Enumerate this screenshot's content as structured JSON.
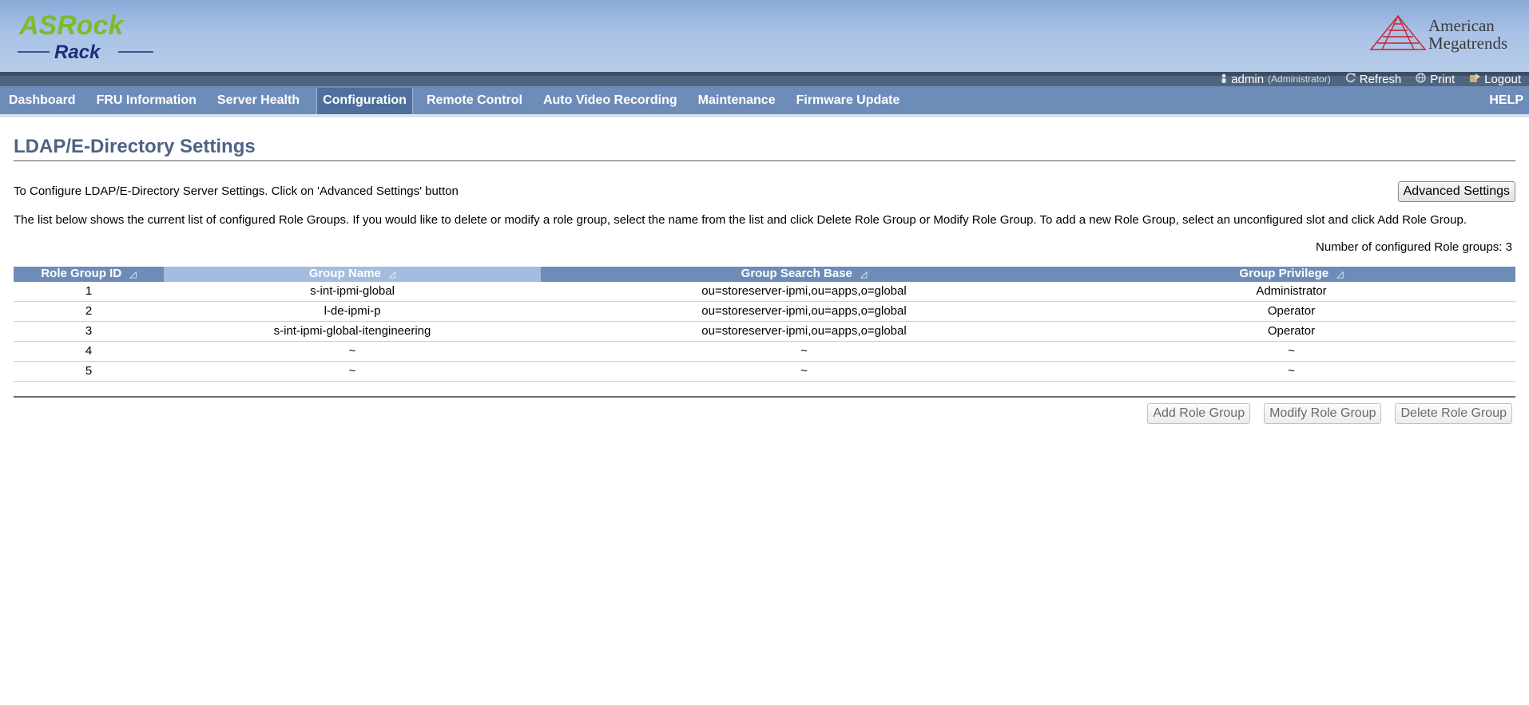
{
  "brand": {
    "left_logo_top": "ASRock",
    "left_logo_bottom": "Rack",
    "right_logo_line1": "American",
    "right_logo_line2": "Megatrends",
    "left_logo_green": "#7dbb2c",
    "left_logo_navy": "#1d2d7a",
    "right_logo_red": "#c8202c"
  },
  "userbar": {
    "user": "admin",
    "role": "(Administrator)",
    "refresh": "Refresh",
    "print": "Print",
    "logout": "Logout"
  },
  "nav": {
    "items": [
      {
        "label": "Dashboard"
      },
      {
        "label": "FRU Information"
      },
      {
        "label": "Server Health"
      },
      {
        "label": "Configuration",
        "active": true
      },
      {
        "label": "Remote Control"
      },
      {
        "label": "Auto Video Recording"
      },
      {
        "label": "Maintenance"
      },
      {
        "label": "Firmware Update"
      }
    ],
    "help": "HELP"
  },
  "page": {
    "title": "LDAP/E-Directory Settings",
    "intro": "To Configure LDAP/E-Directory Server Settings. Click on 'Advanced Settings' button",
    "advanced_button": "Advanced Settings",
    "description": "The list below shows the current list of configured Role Groups. If you would like to delete or modify a role group, select the name from the list and click Delete Role Group or Modify Role Group. To add a new Role Group, select an unconfigured slot and click Add Role Group.",
    "count_label": "Number of configured Role groups: 3"
  },
  "table": {
    "headers": [
      "Role Group ID",
      "Group Name",
      "Group Search Base",
      "Group Privilege"
    ],
    "rows": [
      [
        "1",
        "s-int-ipmi-global",
        "ou=storeserver-ipmi,ou=apps,o=global",
        "Administrator"
      ],
      [
        "2",
        "l-de-ipmi-p",
        "ou=storeserver-ipmi,ou=apps,o=global",
        "Operator"
      ],
      [
        "3",
        "s-int-ipmi-global-itengineering",
        "ou=storeserver-ipmi,ou=apps,o=global",
        "Operator"
      ],
      [
        "4",
        "~",
        "~",
        "~"
      ],
      [
        "5",
        "~",
        "~",
        "~"
      ]
    ]
  },
  "actions": {
    "add": "Add Role Group",
    "modify": "Modify Role Group",
    "delete": "Delete Role Group"
  }
}
